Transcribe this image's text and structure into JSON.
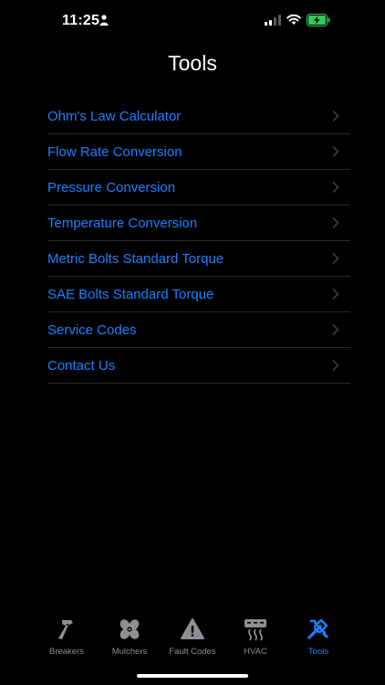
{
  "status_bar": {
    "time": "11:25",
    "icons": [
      "person-icon",
      "cellular-signal-icon",
      "wifi-icon",
      "battery-charging-icon"
    ],
    "battery_color": "#34c759"
  },
  "header": {
    "title": "Tools"
  },
  "tools": [
    {
      "label": "Ohm's Law Calculator",
      "icon": "chevron-right-icon"
    },
    {
      "label": "Flow Rate Conversion",
      "icon": "chevron-right-icon"
    },
    {
      "label": "Pressure Conversion",
      "icon": "chevron-right-icon"
    },
    {
      "label": "Temperature Conversion",
      "icon": "chevron-right-icon"
    },
    {
      "label": "Metric Bolts Standard Torque",
      "icon": "chevron-right-icon"
    },
    {
      "label": "SAE Bolts Standard Torque",
      "icon": "chevron-right-icon"
    },
    {
      "label": "Service Codes",
      "icon": "chevron-right-icon"
    },
    {
      "label": "Contact Us",
      "icon": "chevron-right-icon"
    }
  ],
  "tab_bar": {
    "tabs": [
      {
        "label": "Breakers",
        "icon": "hammer-icon",
        "active": false
      },
      {
        "label": "Mulchers",
        "icon": "fan-icon",
        "active": false
      },
      {
        "label": "Fault Codes",
        "icon": "warning-triangle-icon",
        "active": false
      },
      {
        "label": "HVAC",
        "icon": "hvac-unit-icon",
        "active": false
      },
      {
        "label": "Tools",
        "icon": "wrench-screwdriver-icon",
        "active": true
      }
    ]
  },
  "colors": {
    "accent": "#1a82ff",
    "inactive_tab": "#8e8e93",
    "separator": "#2a2a2c",
    "background": "#000000"
  }
}
